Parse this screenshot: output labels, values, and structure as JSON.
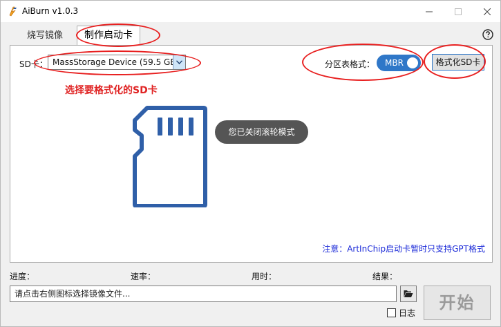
{
  "window": {
    "title": "AiBurn v1.0.3"
  },
  "tabs": [
    {
      "label": "烧写镜像"
    },
    {
      "label": "制作启动卡"
    }
  ],
  "sd_card": {
    "label": "SD卡：",
    "selected_device": "MassStorage Device (59.5 GB)",
    "hint": "选择要格式化的SD卡"
  },
  "partition": {
    "label": "分区表格式：",
    "value": "MBR"
  },
  "format_button": {
    "label": "格式化SD卡"
  },
  "toast": {
    "text": "您已关闭滚轮模式"
  },
  "note": {
    "text": "注意：ArtInChip启动卡暂时只支持GPT格式"
  },
  "status": {
    "progress_label": "进度：",
    "speed_label": "速率：",
    "time_label": "用时：",
    "result_label": "结果："
  },
  "file": {
    "placeholder": "请点击右侧图标选择镜像文件..."
  },
  "log": {
    "label": "日志"
  },
  "start_button": {
    "label": "开始"
  },
  "colors": {
    "accent": "#2f77c8",
    "annotation": "#e82020",
    "hint_red": "#e02424",
    "note_blue": "#1a29d8"
  },
  "icons": {
    "app": "aiburn-logo-icon",
    "help": "help-circle-icon",
    "sd_card": "sd-card-icon",
    "browse": "folder-open-icon",
    "dropdown": "chevron-down-icon"
  }
}
